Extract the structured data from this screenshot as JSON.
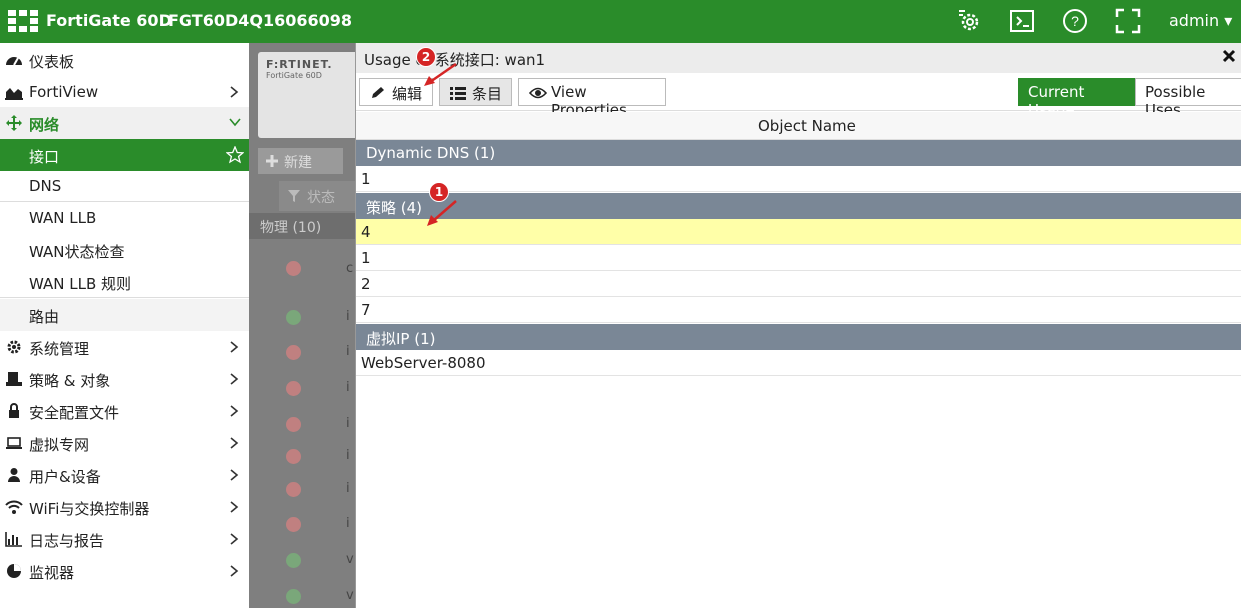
{
  "header": {
    "brand": "FortiGate 60D",
    "serial": "FGT60D4Q16066098",
    "user": "admin",
    "icons": [
      "config-gear-icon",
      "cli-console-icon",
      "help-icon",
      "fullscreen-icon"
    ],
    "color": "#2a8c2a"
  },
  "sidebar": {
    "items": [
      {
        "label": "仪表板",
        "icon": "dashboard-icon"
      },
      {
        "label": "FortiView",
        "icon": "chart-icon"
      },
      {
        "label": "网络",
        "icon": "network-arrows-icon"
      },
      {
        "label": "系统管理",
        "icon": "gear-icon"
      },
      {
        "label": "策略 & 对象",
        "icon": "policy-icon"
      },
      {
        "label": "安全配置文件",
        "icon": "lock-icon"
      },
      {
        "label": "虚拟专网",
        "icon": "laptop-icon"
      },
      {
        "label": "用户&设备",
        "icon": "user-icon"
      },
      {
        "label": "WiFi与交换控制器",
        "icon": "wifi-icon"
      },
      {
        "label": "日志与报告",
        "icon": "bar-chart-icon"
      },
      {
        "label": "监视器",
        "icon": "pie-chart-icon"
      }
    ],
    "network_sub": [
      "接口",
      "DNS",
      "WAN LLB",
      "WAN状态检查",
      "WAN LLB 规则",
      "路由"
    ]
  },
  "background": {
    "logo": "F:RTINET.",
    "model": "FortiGate 60D",
    "new_label": "新建",
    "status_label": "状态",
    "physical_label": "物理 (10)",
    "row_letters": [
      "c",
      "i",
      "i",
      "i",
      "i",
      "i",
      "i",
      "i",
      "v",
      "v"
    ]
  },
  "panel": {
    "title": "Usage of 系统接口: wan1",
    "buttons": {
      "edit": "编辑",
      "entries": "条目",
      "view": "View Properties"
    },
    "toggle": {
      "current": "Current Usage",
      "possible": "Possible Uses"
    },
    "column": "Object Name",
    "groups": [
      {
        "label": "Dynamic DNS (1)",
        "rows": [
          "1"
        ]
      },
      {
        "label": "策略 (4)",
        "rows": [
          "4",
          "1",
          "2",
          "7"
        ]
      },
      {
        "label": "虚拟IP (1)",
        "rows": [
          "WebServer-8080"
        ]
      }
    ]
  },
  "annotations": [
    "1",
    "2"
  ]
}
